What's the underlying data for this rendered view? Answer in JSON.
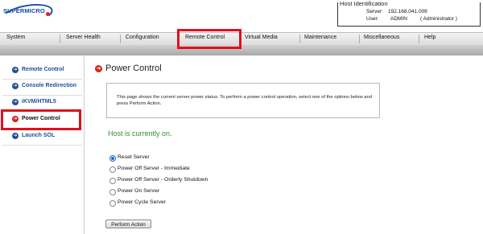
{
  "brand": {
    "logo_text": "SUPERMICRO"
  },
  "host": {
    "legend": "Host Identification",
    "server_label": "Server:",
    "server_value": "192.168.041.009",
    "user_label": "User:",
    "user_value": "ADMIN",
    "user_role": "( Administrator )"
  },
  "nav": {
    "items": [
      "System",
      "Server Health",
      "Configuration",
      "Remote Control",
      "Virtual Media",
      "Maintenance",
      "Miscellaneous",
      "Help"
    ]
  },
  "sidebar": {
    "items": [
      "Remote Control",
      "Console Redirection",
      "iKVM/HTML5",
      "Power Control",
      "Launch SOL"
    ]
  },
  "main": {
    "title": "Power Control",
    "info": "This page shows the current server power status. To perform a power control operation, select one of the options below and press Perform Action.",
    "status": "Host is currently on.",
    "options": [
      "Reset Server",
      "Power Off Server - Immediate",
      "Power Off Server - Orderly Shutdown",
      "Power On Server",
      "Power Cycle Server"
    ],
    "selected": "Reset Server",
    "action_button": "Perform Action"
  },
  "colors": {
    "highlight": "#e0101a",
    "status_green": "#2f8f2f",
    "link_blue": "#1f4e9c"
  }
}
